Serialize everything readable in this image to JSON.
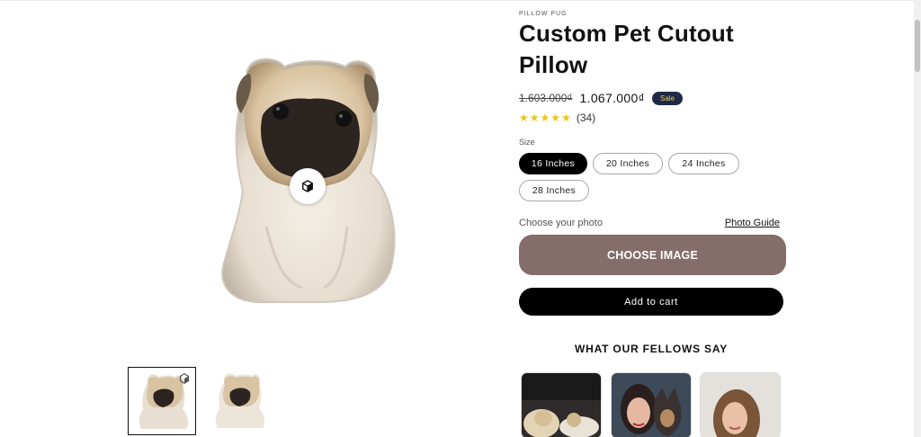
{
  "product": {
    "vendor": "PILLOW PUG",
    "title": "Custom Pet Cutout Pillow",
    "price_old": "1.603.000₫",
    "price_new": "1.067.000₫",
    "sale_badge": "Sale",
    "rating": {
      "stars": 5,
      "count": "(34)"
    },
    "size_label": "Size",
    "sizes": [
      {
        "label": "16 Inches",
        "selected": true
      },
      {
        "label": "20 Inches",
        "selected": false
      },
      {
        "label": "24 Inches",
        "selected": false
      },
      {
        "label": "28 Inches",
        "selected": false
      }
    ],
    "photo_label": "Choose your photo",
    "photo_guide": "Photo Guide",
    "choose_image": "CHOOSE IMAGE",
    "add_to_cart": "Add to cart"
  },
  "gallery": {
    "main_icon": "3d-model-icon",
    "thumbnails": [
      "pug-pillow-3d-thumb",
      "pug-pillow-thumb"
    ]
  },
  "reviews": {
    "heading": "WHAT OUR FELLOWS SAY"
  },
  "colors": {
    "choose_button": "#846d6a",
    "sale_badge_bg": "#1e2a47",
    "sale_badge_text": "#f0c94b",
    "star": "#f2c500"
  }
}
